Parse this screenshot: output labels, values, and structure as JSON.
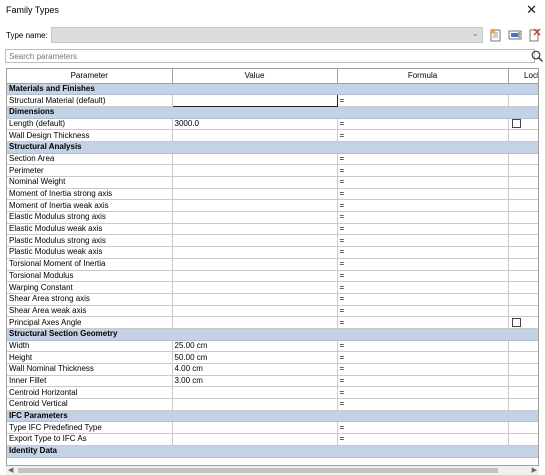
{
  "window": {
    "title": "Family Types",
    "close_glyph": "✕"
  },
  "type_row": {
    "label": "Type name:",
    "value": ""
  },
  "search": {
    "placeholder": "Search parameters"
  },
  "columns": [
    "Parameter",
    "Value",
    "Formula",
    "Lock"
  ],
  "rows": [
    {
      "group": "Materials and Finishes"
    },
    {
      "p": "Structural Material (default)",
      "v": "",
      "f": "=",
      "active": true
    },
    {
      "group": "Dimensions"
    },
    {
      "p": "Length (default)",
      "v": "3000.0",
      "f": "=",
      "lock": true
    },
    {
      "p": "Wall Design Thickness",
      "v": "",
      "f": "="
    },
    {
      "group": "Structural Analysis"
    },
    {
      "p": "Section Area",
      "v": "",
      "f": "="
    },
    {
      "p": "Perimeter",
      "v": "",
      "f": "="
    },
    {
      "p": "Nominal Weight",
      "v": "",
      "f": "="
    },
    {
      "p": "Moment of Inertia strong axis",
      "v": "",
      "f": "="
    },
    {
      "p": "Moment of Inertia weak axis",
      "v": "",
      "f": "="
    },
    {
      "p": "Elastic Modulus strong axis",
      "v": "",
      "f": "="
    },
    {
      "p": "Elastic Modulus weak axis",
      "v": "",
      "f": "="
    },
    {
      "p": "Plastic Modulus strong axis",
      "v": "",
      "f": "="
    },
    {
      "p": "Plastic Modulus weak axis",
      "v": "",
      "f": "="
    },
    {
      "p": "Torsional Moment of Inertia",
      "v": "",
      "f": "="
    },
    {
      "p": "Torsional Modulus",
      "v": "",
      "f": "="
    },
    {
      "p": "Warping Constant",
      "v": "",
      "f": "="
    },
    {
      "p": "Shear Area strong axis",
      "v": "",
      "f": "="
    },
    {
      "p": "Shear Area weak axis",
      "v": "",
      "f": "="
    },
    {
      "p": "Principal Axes Angle",
      "v": "",
      "f": "=",
      "lock": true
    },
    {
      "group": "Structural Section Geometry"
    },
    {
      "p": "Width",
      "v": "25.00 cm",
      "f": "="
    },
    {
      "p": "Height",
      "v": "50.00 cm",
      "f": "="
    },
    {
      "p": "Wall Nominal Thickness",
      "v": "4.00 cm",
      "f": "="
    },
    {
      "p": "Inner Fillet",
      "v": "3.00 cm",
      "f": "="
    },
    {
      "p": "Centroid Horizontal",
      "v": "",
      "f": "="
    },
    {
      "p": "Centroid Vertical",
      "v": "",
      "f": "="
    },
    {
      "group": "IFC Parameters"
    },
    {
      "p": "Type IFC Predefined Type",
      "v": "",
      "f": "="
    },
    {
      "p": "Export Type to IFC As",
      "v": "",
      "f": "="
    },
    {
      "group": "Identity Data"
    }
  ]
}
